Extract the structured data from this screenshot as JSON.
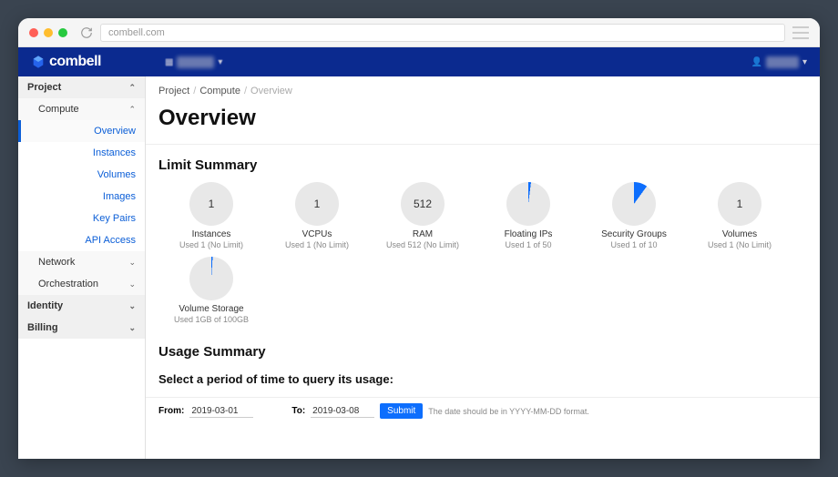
{
  "browser": {
    "url": "combell.com"
  },
  "brand": "combell",
  "breadcrumb": {
    "a": "Project",
    "b": "Compute",
    "c": "Overview"
  },
  "page_title": "Overview",
  "sidebar": {
    "project": "Project",
    "compute": "Compute",
    "items": [
      "Overview",
      "Instances",
      "Volumes",
      "Images",
      "Key Pairs",
      "API Access"
    ],
    "network": "Network",
    "orchestration": "Orchestration",
    "identity": "Identity",
    "billing": "Billing"
  },
  "limit_summary_title": "Limit Summary",
  "gauges": [
    {
      "value": "1",
      "label": "Instances",
      "detail": "Used 1 (No Limit)",
      "pct": 0,
      "text": true
    },
    {
      "value": "1",
      "label": "VCPUs",
      "detail": "Used 1 (No Limit)",
      "pct": 0,
      "text": true
    },
    {
      "value": "512",
      "label": "RAM",
      "detail": "Used 512 (No Limit)",
      "pct": 0,
      "text": true
    },
    {
      "value": "",
      "label": "Floating IPs",
      "detail": "Used 1 of 50",
      "pct": 2,
      "text": false
    },
    {
      "value": "",
      "label": "Security Groups",
      "detail": "Used 1 of 10",
      "pct": 10,
      "text": false
    },
    {
      "value": "1",
      "label": "Volumes",
      "detail": "Used 1 (No Limit)",
      "pct": 0,
      "text": true
    },
    {
      "value": "",
      "label": "Volume Storage",
      "detail": "Used 1GB of 100GB",
      "pct": 1,
      "text": false
    }
  ],
  "usage_summary_title": "Usage Summary",
  "query_title": "Select a period of time to query its usage:",
  "form": {
    "from_label": "From:",
    "from_value": "2019-03-01",
    "to_label": "To:",
    "to_value": "2019-03-08",
    "submit": "Submit",
    "hint": "The date should be in YYYY-MM-DD format."
  },
  "colors": {
    "accent": "#0d6efd",
    "gauge_bg": "#e8e8e8"
  }
}
